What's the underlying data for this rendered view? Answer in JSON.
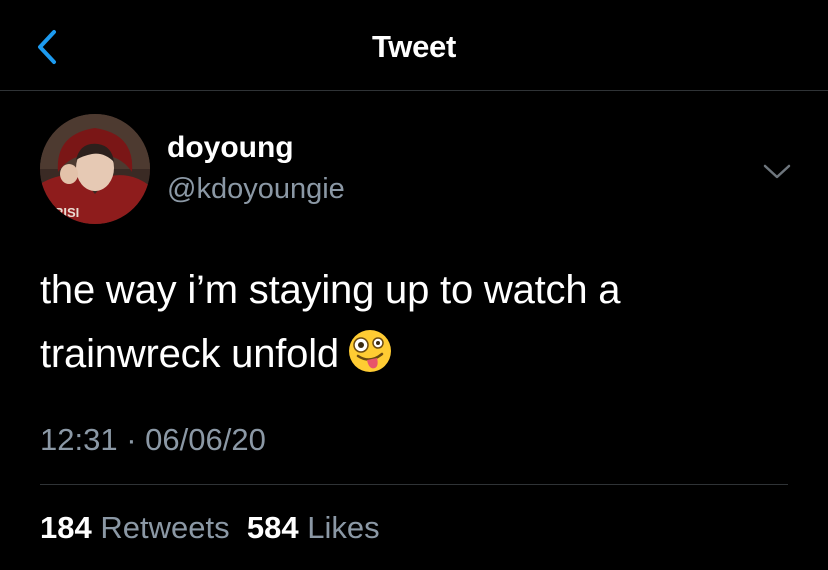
{
  "header": {
    "title": "Tweet",
    "back_icon": "chevron-left-icon"
  },
  "tweet": {
    "author": {
      "display_name": "doyoung",
      "handle": "@kdoyoungie"
    },
    "text": "the way i’m staying up to watch a trainwreck unfold",
    "emoji": "zany-face-emoji",
    "time": "12:31",
    "separator": "·",
    "date": "06/06/20",
    "stats": {
      "retweets_count": "184",
      "retweets_label": "Retweets",
      "likes_count": "584",
      "likes_label": "Likes"
    }
  },
  "colors": {
    "background": "#000000",
    "text": "#ffffff",
    "secondary_text": "#8b98a5",
    "accent": "#1d9bf0",
    "divider": "#2f3336"
  }
}
